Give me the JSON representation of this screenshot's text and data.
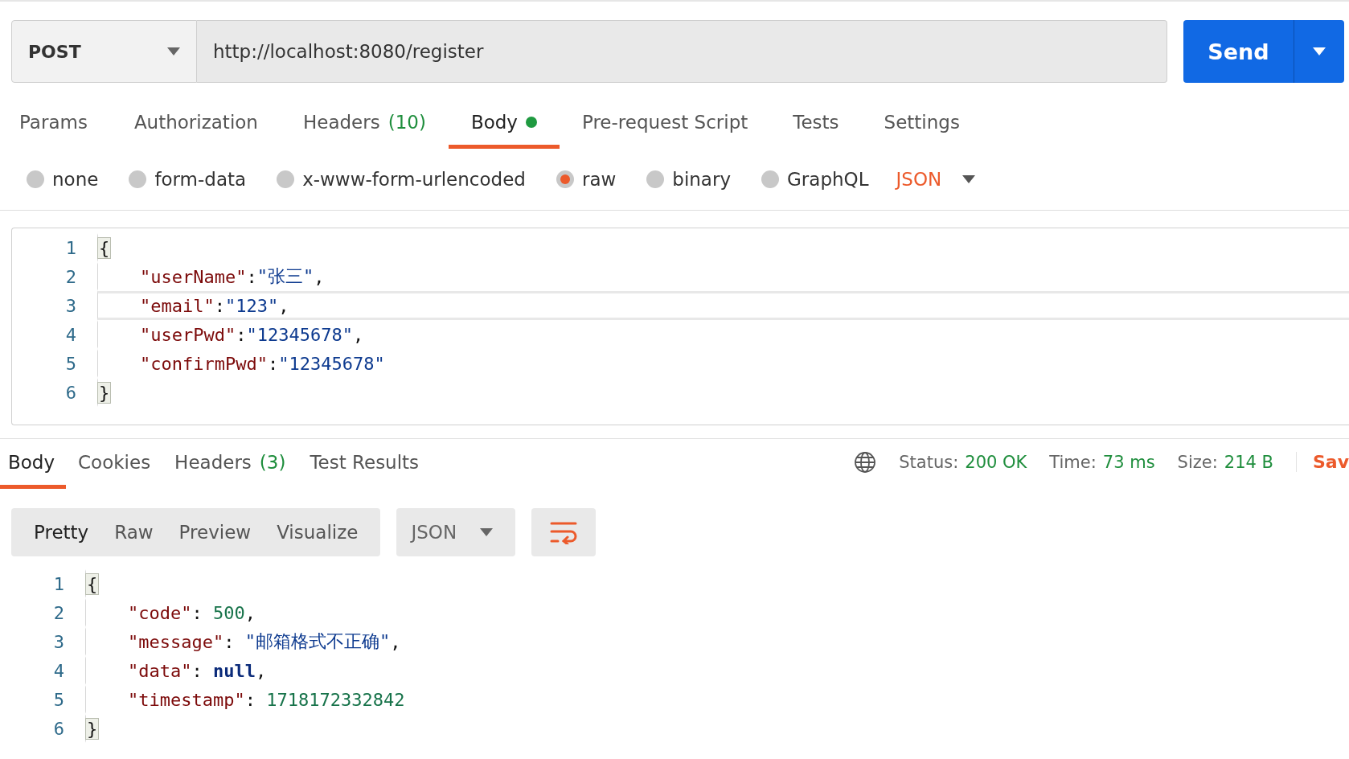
{
  "request": {
    "method": "POST",
    "url": "http://localhost:8080/register",
    "send_label": "Send"
  },
  "request_tabs": [
    {
      "label": "Params",
      "selected": false
    },
    {
      "label": "Authorization",
      "selected": false
    },
    {
      "label": "Headers",
      "count": "(10)",
      "selected": false
    },
    {
      "label": "Body",
      "dot": true,
      "selected": true
    },
    {
      "label": "Pre-request Script",
      "selected": false
    },
    {
      "label": "Tests",
      "selected": false
    },
    {
      "label": "Settings",
      "selected": false
    }
  ],
  "body_types": [
    {
      "label": "none",
      "selected": false
    },
    {
      "label": "form-data",
      "selected": false
    },
    {
      "label": "x-www-form-urlencoded",
      "selected": false
    },
    {
      "label": "raw",
      "selected": true
    },
    {
      "label": "binary",
      "selected": false
    },
    {
      "label": "GraphQL",
      "selected": false
    }
  ],
  "body_format": "JSON",
  "request_body": [
    {
      "number": "1",
      "active": false,
      "indented": false,
      "tokens": [
        {
          "kind": "bracket",
          "text": "{"
        }
      ]
    },
    {
      "number": "2",
      "active": false,
      "indented": true,
      "tokens": [
        {
          "kind": "key",
          "text": "\"userName\""
        },
        {
          "kind": "punct",
          "text": ":"
        },
        {
          "kind": "string",
          "text": "\"张三\""
        },
        {
          "kind": "punct",
          "text": ","
        }
      ]
    },
    {
      "number": "3",
      "active": true,
      "indented": true,
      "tokens": [
        {
          "kind": "key",
          "text": "\"email\""
        },
        {
          "kind": "punct",
          "text": ":"
        },
        {
          "kind": "string",
          "text": "\"123\""
        },
        {
          "kind": "punct",
          "text": ","
        }
      ]
    },
    {
      "number": "4",
      "active": false,
      "indented": true,
      "tokens": [
        {
          "kind": "key",
          "text": "\"userPwd\""
        },
        {
          "kind": "punct",
          "text": ":"
        },
        {
          "kind": "string",
          "text": "\"12345678\""
        },
        {
          "kind": "punct",
          "text": ","
        }
      ]
    },
    {
      "number": "5",
      "active": false,
      "indented": true,
      "tokens": [
        {
          "kind": "key",
          "text": "\"confirmPwd\""
        },
        {
          "kind": "punct",
          "text": ":"
        },
        {
          "kind": "string",
          "text": "\"12345678\""
        }
      ]
    },
    {
      "number": "6",
      "active": false,
      "indented": false,
      "tokens": [
        {
          "kind": "bracket",
          "text": "}"
        }
      ]
    }
  ],
  "response_tabs": [
    {
      "label": "Body",
      "selected": true
    },
    {
      "label": "Cookies",
      "selected": false
    },
    {
      "label": "Headers",
      "count": "(3)",
      "selected": false
    },
    {
      "label": "Test Results",
      "selected": false
    }
  ],
  "status": [
    {
      "label": "Status:",
      "value": "200 OK"
    },
    {
      "label": "Time:",
      "value": "73 ms"
    },
    {
      "label": "Size:",
      "value": "214 B"
    }
  ],
  "save_label": "Sav",
  "view_modes": [
    {
      "label": "Pretty",
      "selected": true
    },
    {
      "label": "Raw",
      "selected": false
    },
    {
      "label": "Preview",
      "selected": false
    },
    {
      "label": "Visualize",
      "selected": false
    }
  ],
  "response_format": "JSON",
  "response_body": [
    {
      "number": "1",
      "active": false,
      "indented": false,
      "tokens": [
        {
          "kind": "bracket",
          "text": "{"
        }
      ]
    },
    {
      "number": "2",
      "active": false,
      "indented": true,
      "tokens": [
        {
          "kind": "key",
          "text": "\"code\""
        },
        {
          "kind": "punct",
          "text": ": "
        },
        {
          "kind": "number",
          "text": "500"
        },
        {
          "kind": "punct",
          "text": ","
        }
      ]
    },
    {
      "number": "3",
      "active": false,
      "indented": true,
      "tokens": [
        {
          "kind": "key",
          "text": "\"message\""
        },
        {
          "kind": "punct",
          "text": ": "
        },
        {
          "kind": "string",
          "text": "\"邮箱格式不正确\""
        },
        {
          "kind": "punct",
          "text": ","
        }
      ]
    },
    {
      "number": "4",
      "active": false,
      "indented": true,
      "tokens": [
        {
          "kind": "key",
          "text": "\"data\""
        },
        {
          "kind": "punct",
          "text": ": "
        },
        {
          "kind": "keyword",
          "text": "null"
        },
        {
          "kind": "punct",
          "text": ","
        }
      ]
    },
    {
      "number": "5",
      "active": false,
      "indented": true,
      "tokens": [
        {
          "kind": "key",
          "text": "\"timestamp\""
        },
        {
          "kind": "punct",
          "text": ": "
        },
        {
          "kind": "number",
          "text": "1718172332842"
        }
      ]
    },
    {
      "number": "6",
      "active": false,
      "indented": false,
      "tokens": [
        {
          "kind": "bracket",
          "text": "}"
        }
      ]
    }
  ]
}
